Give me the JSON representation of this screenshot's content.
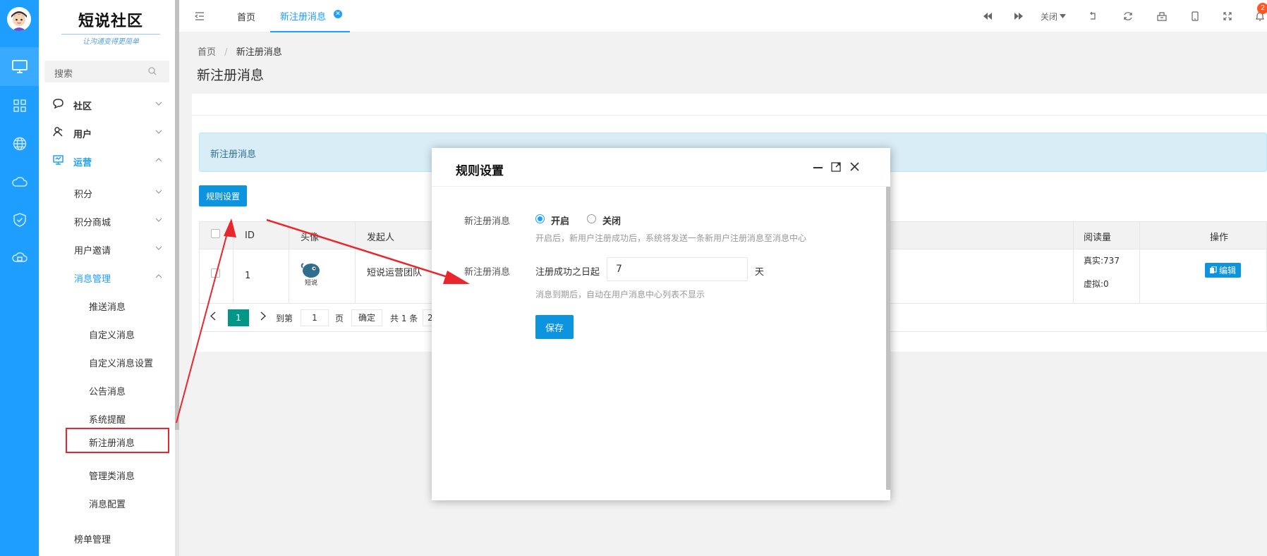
{
  "sidebar": {
    "logo_title": "短说社区",
    "logo_slogan": "让沟通变得更简单",
    "search_placeholder": "搜索",
    "menu": {
      "community": "社区",
      "users": "用户",
      "operations": "运营",
      "points": "积分",
      "points_mall": "积分商城",
      "invite": "用户邀请",
      "messages": "消息管理",
      "push": "推送消息",
      "custom": "自定义消息",
      "custom_settings": "自定义消息设置",
      "announce": "公告消息",
      "system": "系统提醒",
      "new_register": "新注册消息",
      "admin_msg": "管理类消息",
      "msg_config": "消息配置",
      "ranking": "榜单管理"
    }
  },
  "topbar": {
    "tab_home": "首页",
    "tab_active": "新注册消息",
    "close_label": "关闭",
    "notify_count": "2"
  },
  "content": {
    "breadcrumb_home": "首页",
    "breadcrumb_sep": "/",
    "breadcrumb_current": "新注册消息",
    "page_title": "新注册消息",
    "alert_text": "新注册消息",
    "rule_button": "规则设置"
  },
  "table": {
    "headers": {
      "id": "ID",
      "avatar": "头像",
      "sender": "发起人",
      "reads": "阅读量",
      "action": "操作"
    },
    "rows": [
      {
        "id": "1",
        "avatar_text": "短说",
        "sender": "短说运营团队",
        "reads_real": "真实:737",
        "reads_virtual": "虚拟:0",
        "edit": "编辑"
      }
    ]
  },
  "pager": {
    "current_page": "1",
    "goto_label": "到第",
    "page_input": "1",
    "page_unit": "页",
    "confirm": "确定",
    "total": "共 1 条",
    "size_partial": "2"
  },
  "dialog": {
    "title": "规则设置",
    "field1_label": "新注册消息",
    "radio_on": "开启",
    "radio_off": "关闭",
    "radio_selected": "开启",
    "field1_hint": "开启后，新用户注册成功后，系统将发送一条新用户注册消息至消息中心",
    "field2_label": "新注册消息",
    "field2_prefix": "注册成功之日起",
    "days_value": "7",
    "days_unit": "天",
    "field2_hint": "消息到期后，自动在用户消息中心列表不显示",
    "save": "保存"
  },
  "colors": {
    "rail": "#1e9fff",
    "accent": "#1e9fff",
    "button": "#0c94e0",
    "pager_active": "#009688",
    "alert_bg": "#d9edf7",
    "annotation": "#e8262b"
  }
}
